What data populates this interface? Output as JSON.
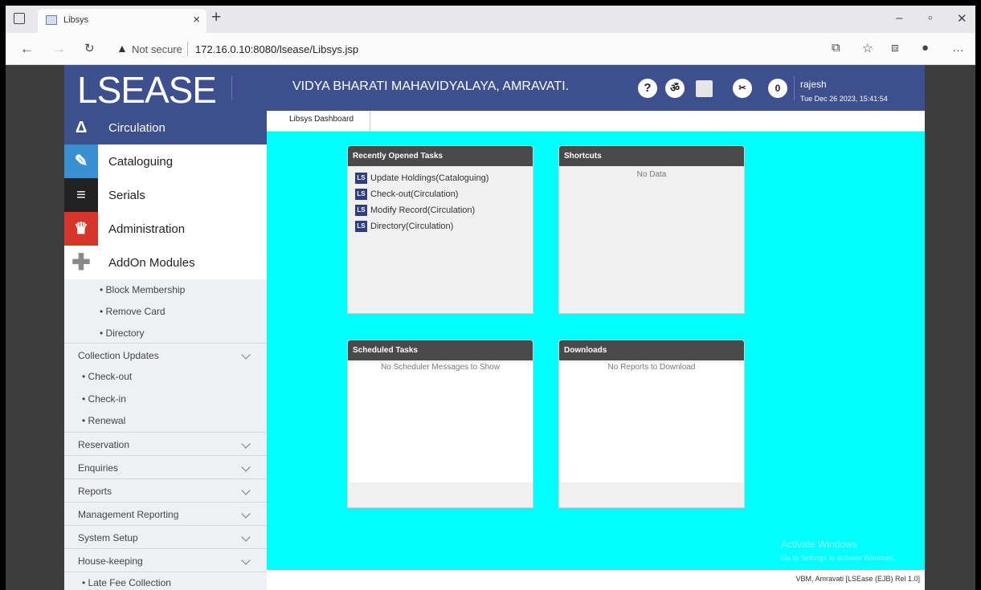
{
  "browser": {
    "tab_title": "Libsys",
    "new_tab": "+",
    "address_warning": "Not secure",
    "url": "172.16.0.10:8080/lsease/Libsys.jsp"
  },
  "header": {
    "logo": "LSEASE",
    "college": "VIDYA BHARATI MAHAVIDYALAYA, AMRAVATI.",
    "help": "?",
    "notification_count": "0",
    "user": "rajesh",
    "datetime": "Tue Dec 26 2023, 15:41:54"
  },
  "sidebar": {
    "modules": [
      {
        "label": "Circulation",
        "color": "#3d4f8c"
      },
      {
        "label": "Cataloguing",
        "color": "#3a8fd0"
      },
      {
        "label": "Serials",
        "color": "#222222"
      },
      {
        "label": "Administration",
        "color": "#d8352a"
      },
      {
        "label": "AddOn Modules",
        "color": "#ffffff"
      }
    ],
    "subitems_top": [
      "• Block Membership",
      "• Remove Card",
      "• Directory"
    ],
    "collection_updates": "Collection Updates",
    "collection_items": [
      "• Check-out",
      "• Check-in",
      "• Renewal"
    ],
    "groups": [
      "Reservation",
      "Enquiries",
      "Reports",
      "Management Reporting",
      "System Setup",
      "House-keeping"
    ],
    "last_item": "• Late Fee Collection"
  },
  "main": {
    "tab": "Libsys Dashboard",
    "recent": {
      "title": "Recently Opened Tasks",
      "badge": "LS",
      "tasks": [
        "Update Holdings(Cataloguing)",
        "Check-out(Circulation)",
        "Modify Record(Circulation)",
        "Directory(Circulation)"
      ]
    },
    "shortcuts": {
      "title": "Shortcuts",
      "empty": "No Data"
    },
    "scheduled": {
      "title": "Scheduled Tasks",
      "empty": "No Scheduler Messages to Show"
    },
    "downloads": {
      "title": "Downloads",
      "empty": "No Reports to Download"
    },
    "footer": "VBM, Amravati [LSEase (EJB) Rel 1.0]",
    "watermark": "Activate Windows",
    "watermark_sub": "Go to Settings to activate Windows."
  }
}
